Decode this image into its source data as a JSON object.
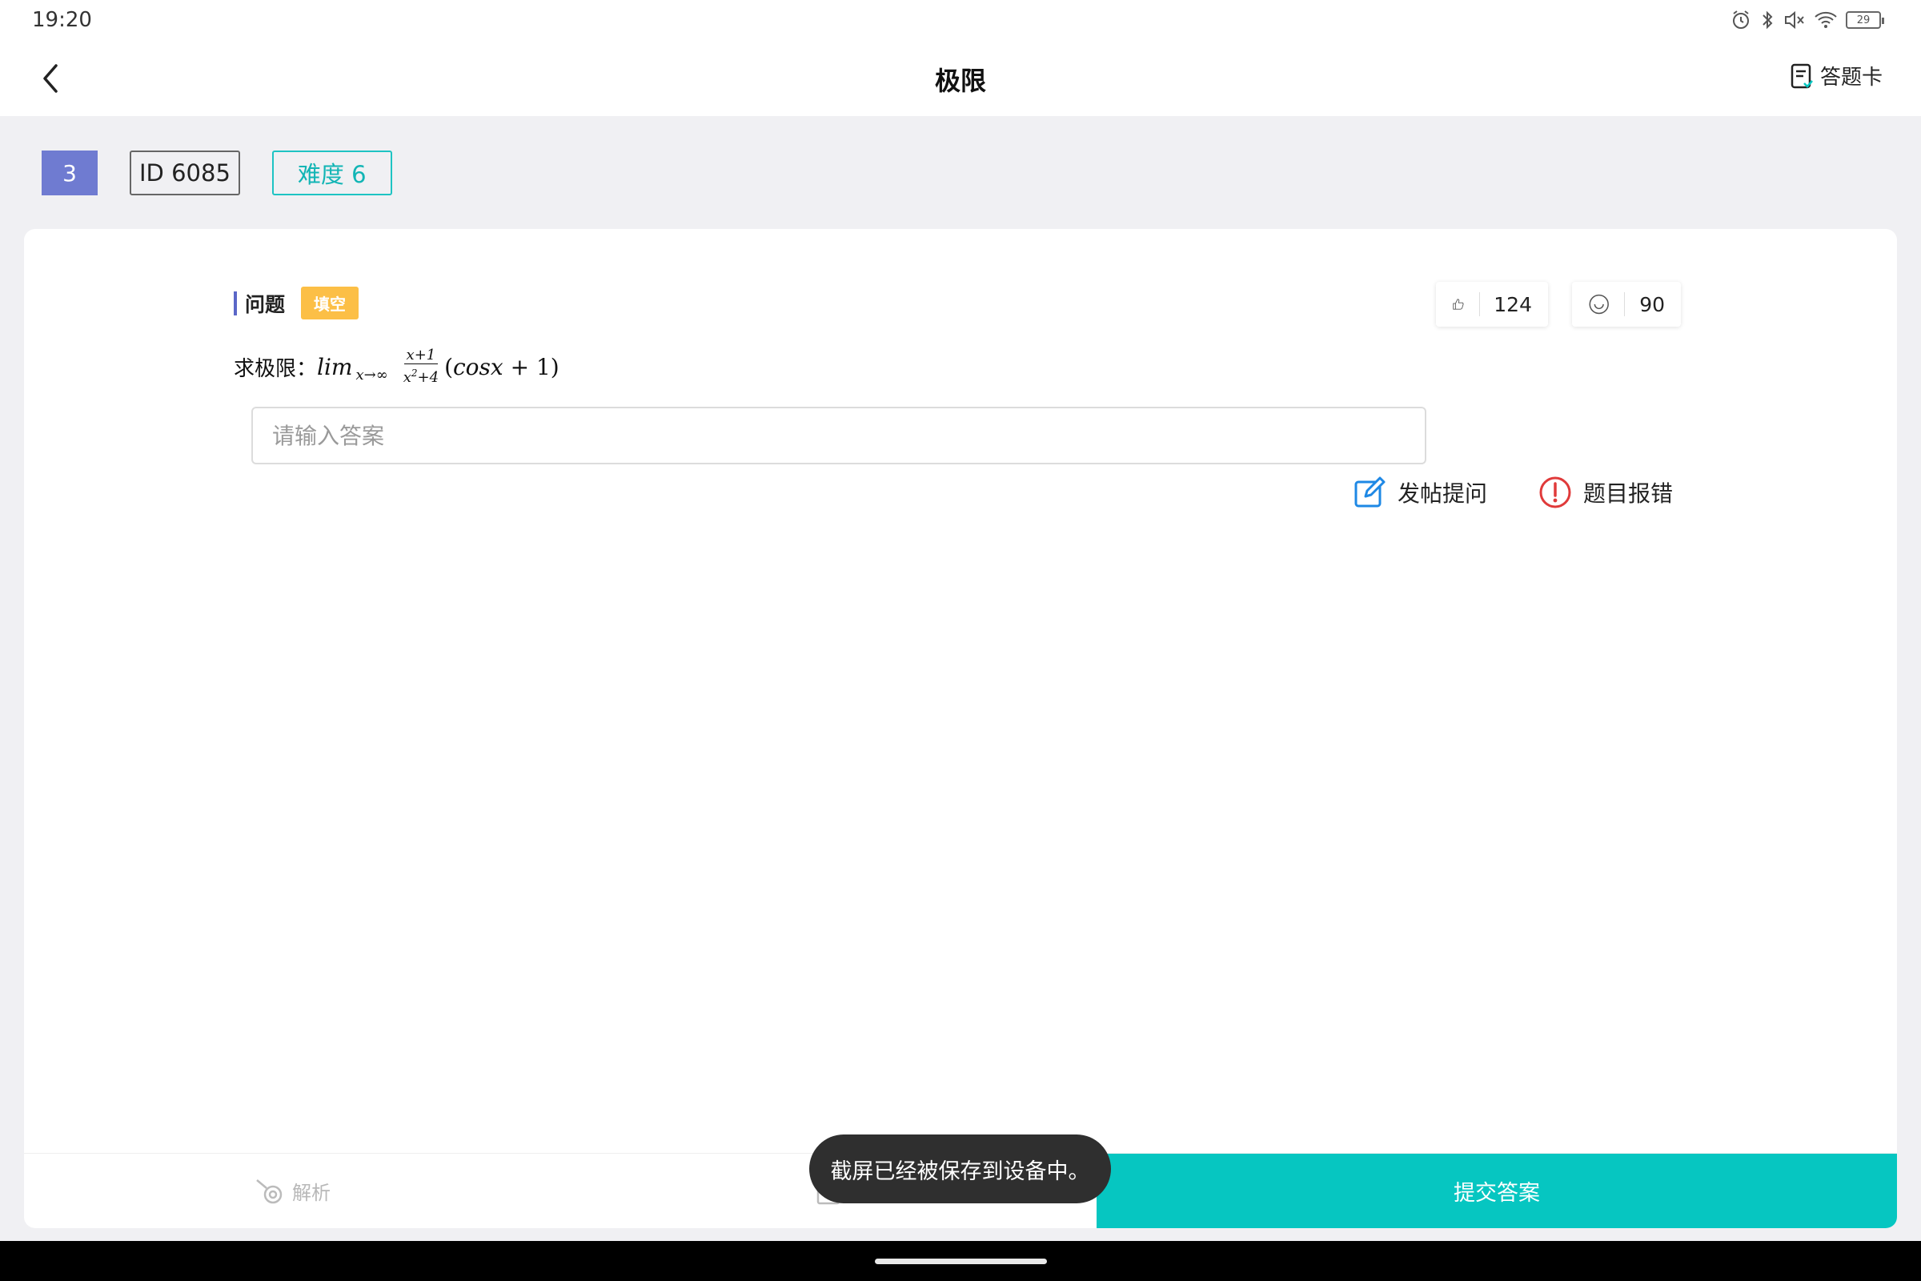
{
  "status_bar": {
    "time": "19:20",
    "battery": "29"
  },
  "header": {
    "title": "极限",
    "answer_card_label": "答题卡"
  },
  "tags": {
    "number": "3",
    "id": "ID 6085",
    "difficulty": "难度 6"
  },
  "question": {
    "section_label": "问题",
    "type_badge": "填空",
    "stem_prefix": "求极限：",
    "math": {
      "lim": "lim",
      "sub": "x→∞",
      "num": "x+1",
      "den_x": "x",
      "den_exp": "2",
      "den_rest": "+4",
      "paren_open": "(",
      "cos": "cosx",
      "plus_one": " + 1)"
    },
    "likes": "124",
    "smiles": "90",
    "input_placeholder": "请输入答案",
    "post_question_label": "发帖提问",
    "report_error_label": "题目报错"
  },
  "bottom_bar": {
    "analysis_label": "解析",
    "submit_label": "提交答案"
  },
  "toast": "截屏已经被保存到设备中。",
  "colors": {
    "accent_teal": "#06c6c1",
    "tag_blue": "#6f7bd1",
    "badge_yellow": "#fcbf46",
    "error_red": "#e03a3a",
    "edit_blue": "#1e88e5"
  }
}
